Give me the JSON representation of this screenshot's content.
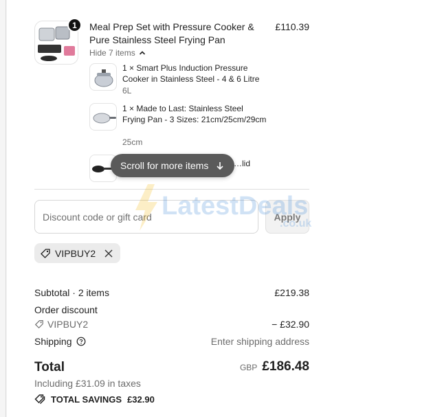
{
  "product": {
    "quantity_badge": "1",
    "title": "Meal Prep Set with Pressure Cooker & Pure Stainless Steel Frying Pan",
    "price": "£110.39",
    "toggle_label": "Hide 7 items",
    "toggle_icon": "chevron-up-icon"
  },
  "bundle_items": [
    {
      "title": "1 × Smart Plus Induction Pressure Cooker in Stainless Steel - 4 & 6 Litre",
      "variant": "6L"
    },
    {
      "title": "1 × Made to Last: Stainless Steel Frying Pan - 3 Sizes: 21cm/25cm/29cm",
      "variant": "25cm"
    },
    {
      "title": "…lid",
      "variant": ""
    }
  ],
  "scroll_hint": {
    "label": "Scroll for more items",
    "icon": "arrow-down-icon"
  },
  "discount": {
    "placeholder": "Discount code or gift card",
    "apply_label": "Apply",
    "applied_code": "VIPBUY2"
  },
  "summary": {
    "subtotal_label": "Subtotal · 2 items",
    "subtotal_value": "£219.38",
    "order_discount_label": "Order discount",
    "discount_code": "VIPBUY2",
    "discount_value": "− £32.90",
    "shipping_label": "Shipping",
    "shipping_value": "Enter shipping address",
    "total_label": "Total",
    "currency": "GBP",
    "total_value": "£186.48",
    "taxes_note": "Including £31.09 in taxes",
    "savings_label": "TOTAL SAVINGS",
    "savings_value": "£32.90"
  },
  "watermark": {
    "text": "LatestDeals",
    "suffix": ".co.uk"
  },
  "colors": {
    "pill_bg": "#5a5a5a",
    "text": "#1f1f1f",
    "muted": "#6b6b6b",
    "chip_bg": "#ebebeb"
  }
}
